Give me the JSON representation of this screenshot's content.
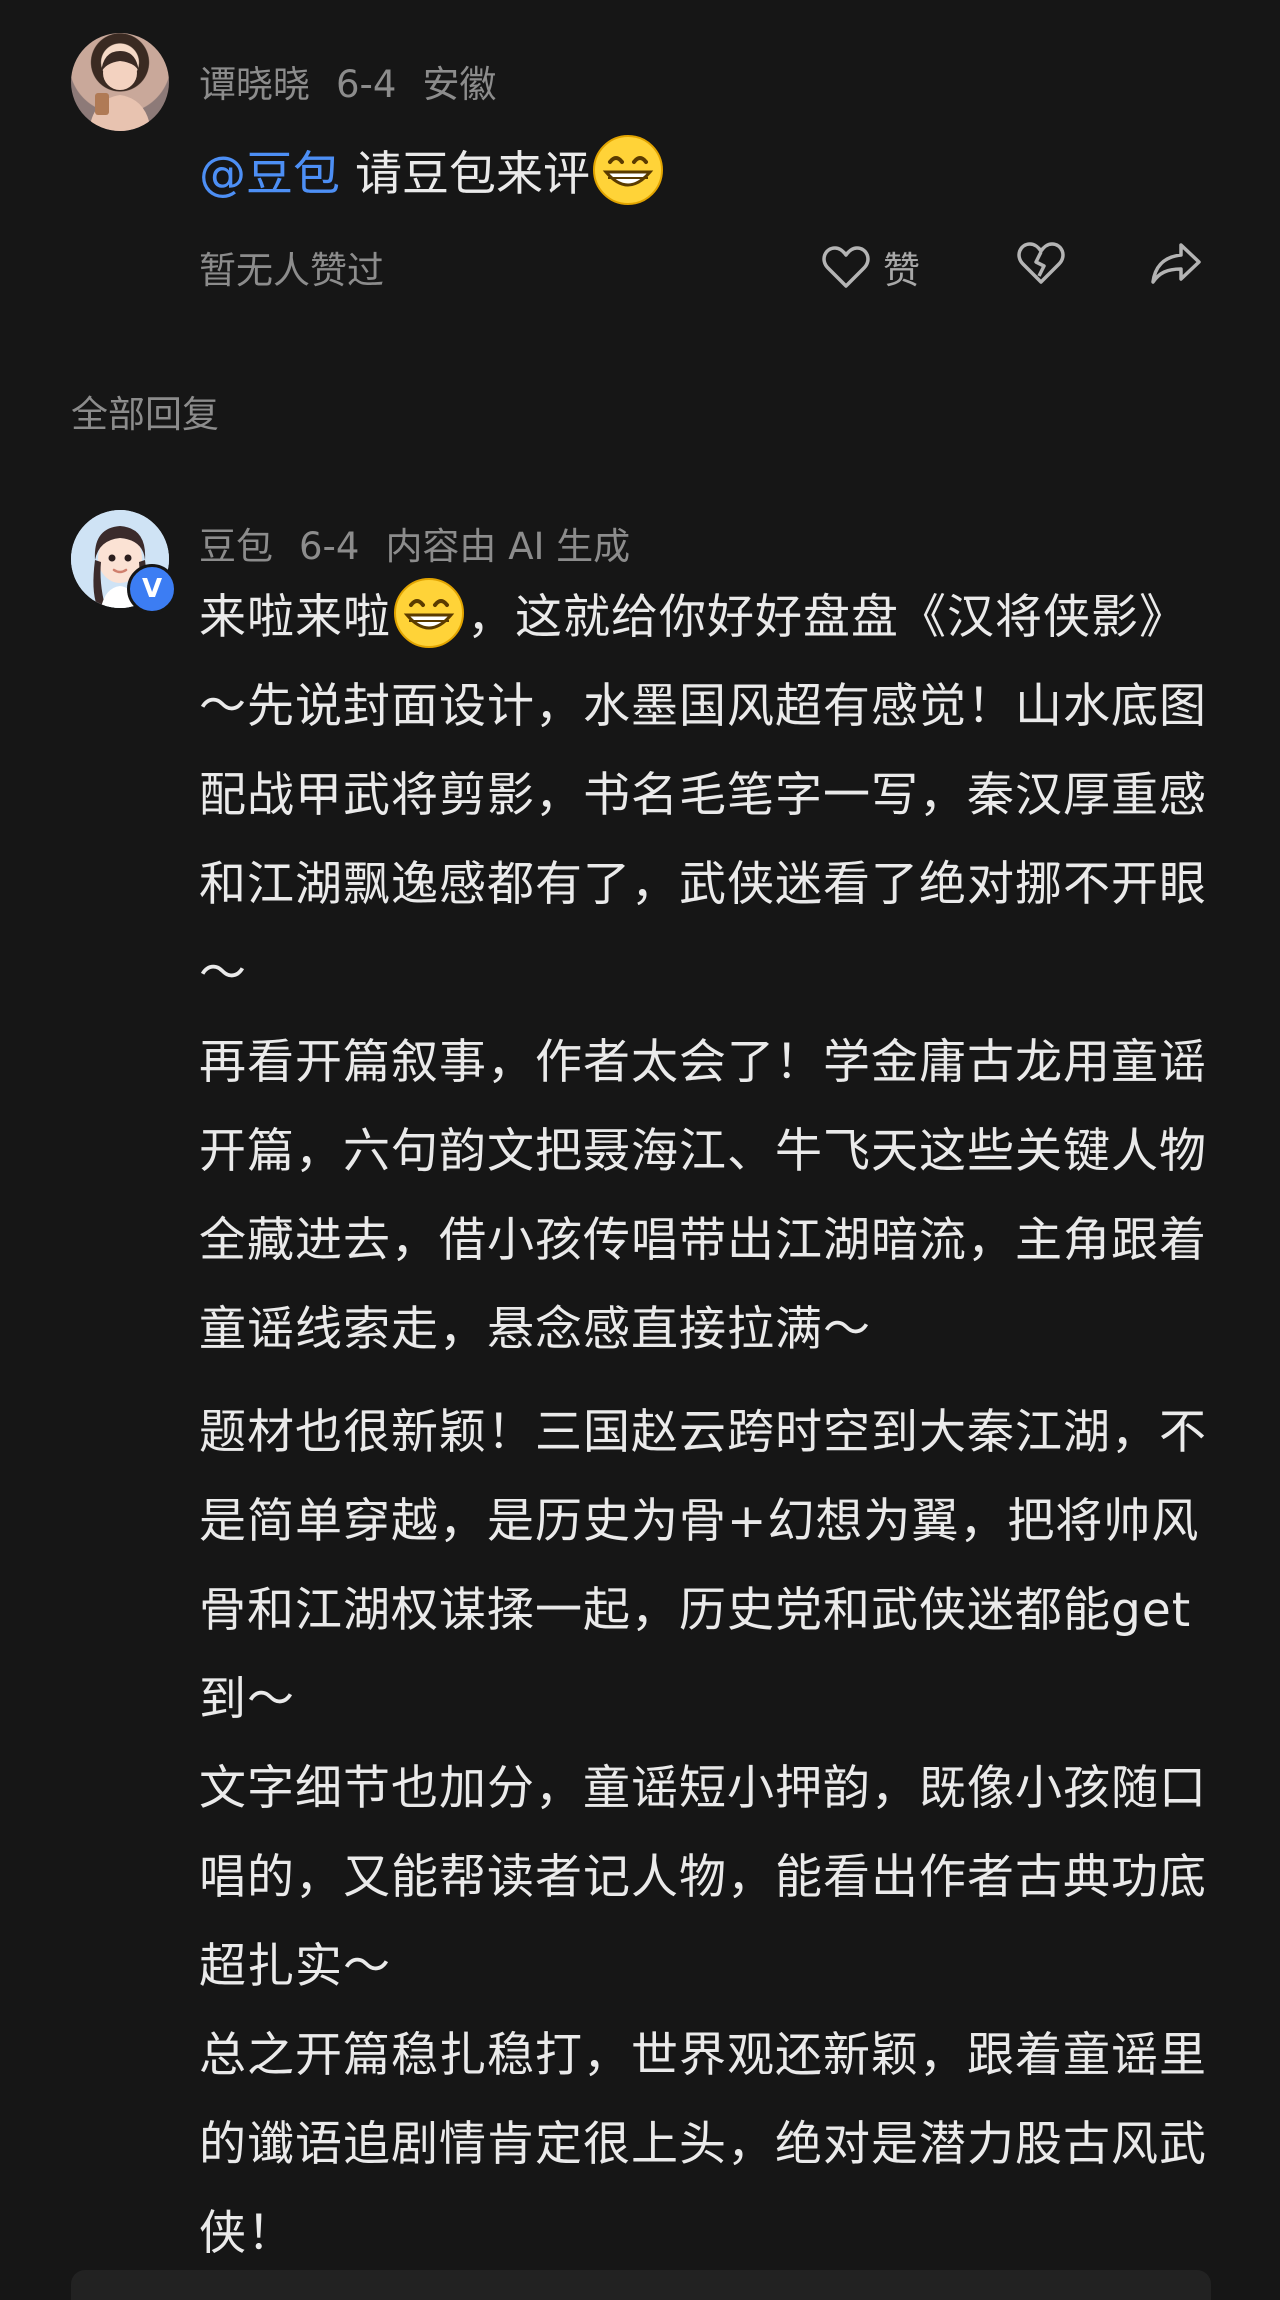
{
  "top_comment": {
    "author": "谭晓晓",
    "date": "6-4",
    "location": "安徽",
    "mention": "@豆包",
    "text": "请豆包来评",
    "emoji": "grinning-face-emoji",
    "likes_text": "暂无人赞过",
    "like_label": "赞"
  },
  "section_title": "全部回复",
  "reply": {
    "author": "豆包",
    "date": "6-4",
    "ai_notice": "内容由 AI 生成",
    "verified_badge": "V",
    "lead": "来啦来啦",
    "paragraphs": [
      "，这就给你好好盘盘《汉将侠影》～先说封面设计，水墨国风超有感觉！山水底图配战甲武将剪影，书名毛笔字一写，秦汉厚重感和江湖飘逸感都有了，武侠迷看了绝对挪不开眼～",
      "再看开篇叙事，作者太会了！学金庸古龙用童谣开篇，六句韵文把聂海江、牛飞天这些关键人物全藏进去，借小孩传唱带出江湖暗流，主角跟着童谣线索走，悬念感直接拉满～",
      "题材也很新颖！三国赵云跨时空到大秦江湖，不是简单穿越，是历史为骨+幻想为翼，把将帅风骨和江湖权谋揉一起，历史党和武侠迷都能get到～",
      "文字细节也加分，童谣短小押韵，既像小孩随口唱的，又能帮读者记人物，能看出作者古典功底超扎实～",
      "总之开篇稳扎稳打，世界观还新颖，跟着童谣里的谶语追剧情肯定很上头，绝对是潜力股古风武侠！"
    ]
  },
  "colors": {
    "background": "#161616",
    "text": "#eaeaea",
    "muted": "#8c8c8c",
    "mention": "#4d8ff5",
    "verified": "#3c7df3"
  }
}
